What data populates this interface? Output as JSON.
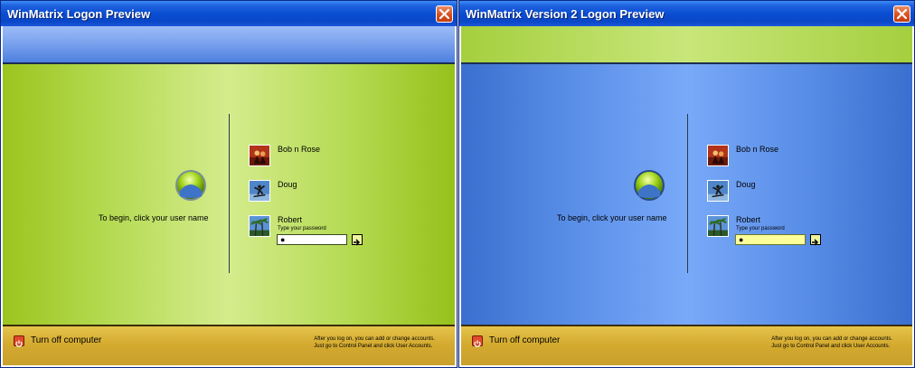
{
  "windows": [
    {
      "title": "WinMatrix Logon Preview",
      "begin_text": "To begin, click your user name",
      "users": [
        {
          "name": "Bob n Rose",
          "avatar": "red-performer-avatar"
        },
        {
          "name": "Doug",
          "avatar": "skater-avatar"
        },
        {
          "name": "Robert",
          "avatar": "palm-trees-avatar"
        }
      ],
      "password_label": "Type your password",
      "password_value": "●",
      "turn_off_label": "Turn off computer",
      "hint_line1": "After you log on, you can add or change accounts.",
      "hint_line2": "Just go to Control Panel and click User Accounts."
    },
    {
      "title": "WinMatrix Version 2 Logon Preview",
      "begin_text": "To begin, click your user name",
      "users": [
        {
          "name": "Bob n Rose",
          "avatar": "red-performer-avatar"
        },
        {
          "name": "Doug",
          "avatar": "skater-avatar"
        },
        {
          "name": "Robert",
          "avatar": "palm-trees-avatar"
        }
      ],
      "password_label": "Type your password",
      "password_value": "●",
      "turn_off_label": "Turn off computer",
      "hint_line1": "After you log on, you can add or change accounts.",
      "hint_line2": "Just go to Control Panel and click User Accounts."
    }
  ],
  "icons": {
    "close": "close-icon",
    "logo": "windows-logo-icon",
    "go": "arrow-right-icon",
    "power": "power-icon"
  },
  "colors": {
    "titlebar": "#0a4ed3",
    "v1_main": "#b3d94f",
    "v2_main": "#5a8fe8",
    "footer": "#d3a92e",
    "close_button": "#d8501e"
  }
}
